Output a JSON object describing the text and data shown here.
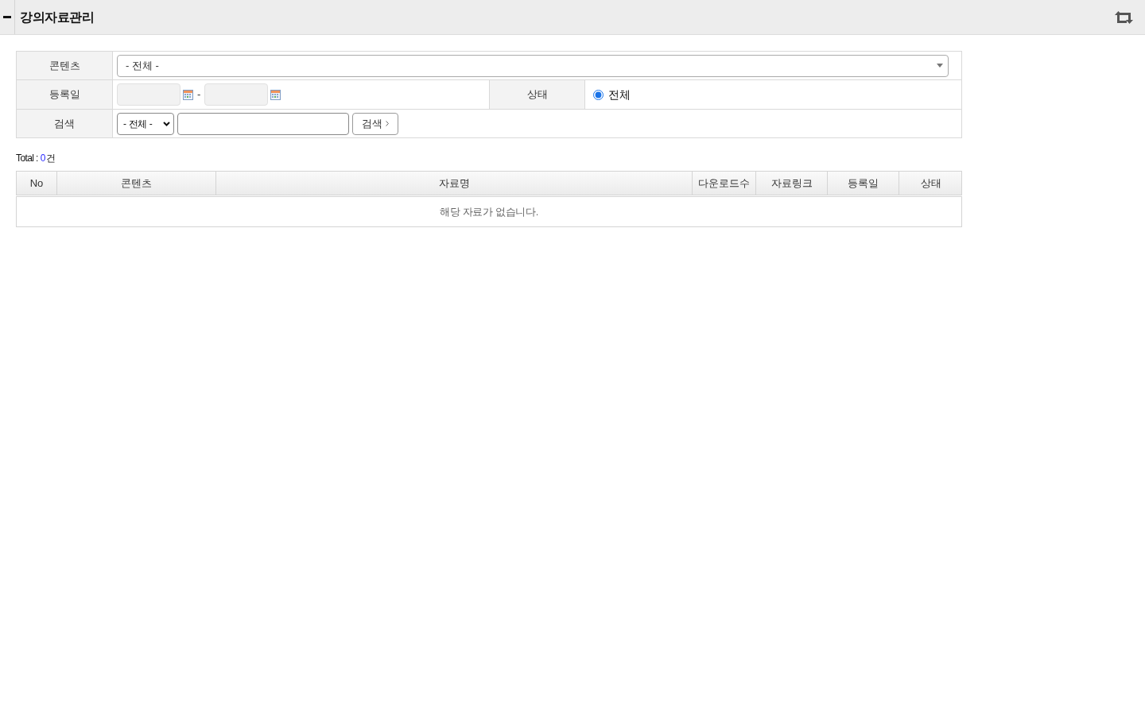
{
  "header": {
    "title": "강의자료관리"
  },
  "filters": {
    "content": {
      "label": "콘텐츠",
      "value": "- 전체 -"
    },
    "date": {
      "label": "등록일",
      "separator": "-"
    },
    "status": {
      "label": "상태",
      "options": [
        {
          "label": "전체",
          "selected": true
        }
      ]
    },
    "search": {
      "label": "검색",
      "scope": "- 전체 -",
      "button": "검색"
    }
  },
  "total": {
    "label": "Total :",
    "count": "0",
    "unit": "건"
  },
  "table": {
    "columns": [
      "No",
      "콘텐츠",
      "자료명",
      "다운로드수",
      "자료링크",
      "등록일",
      "상태"
    ],
    "empty_message": "해당 자료가 없습니다."
  }
}
